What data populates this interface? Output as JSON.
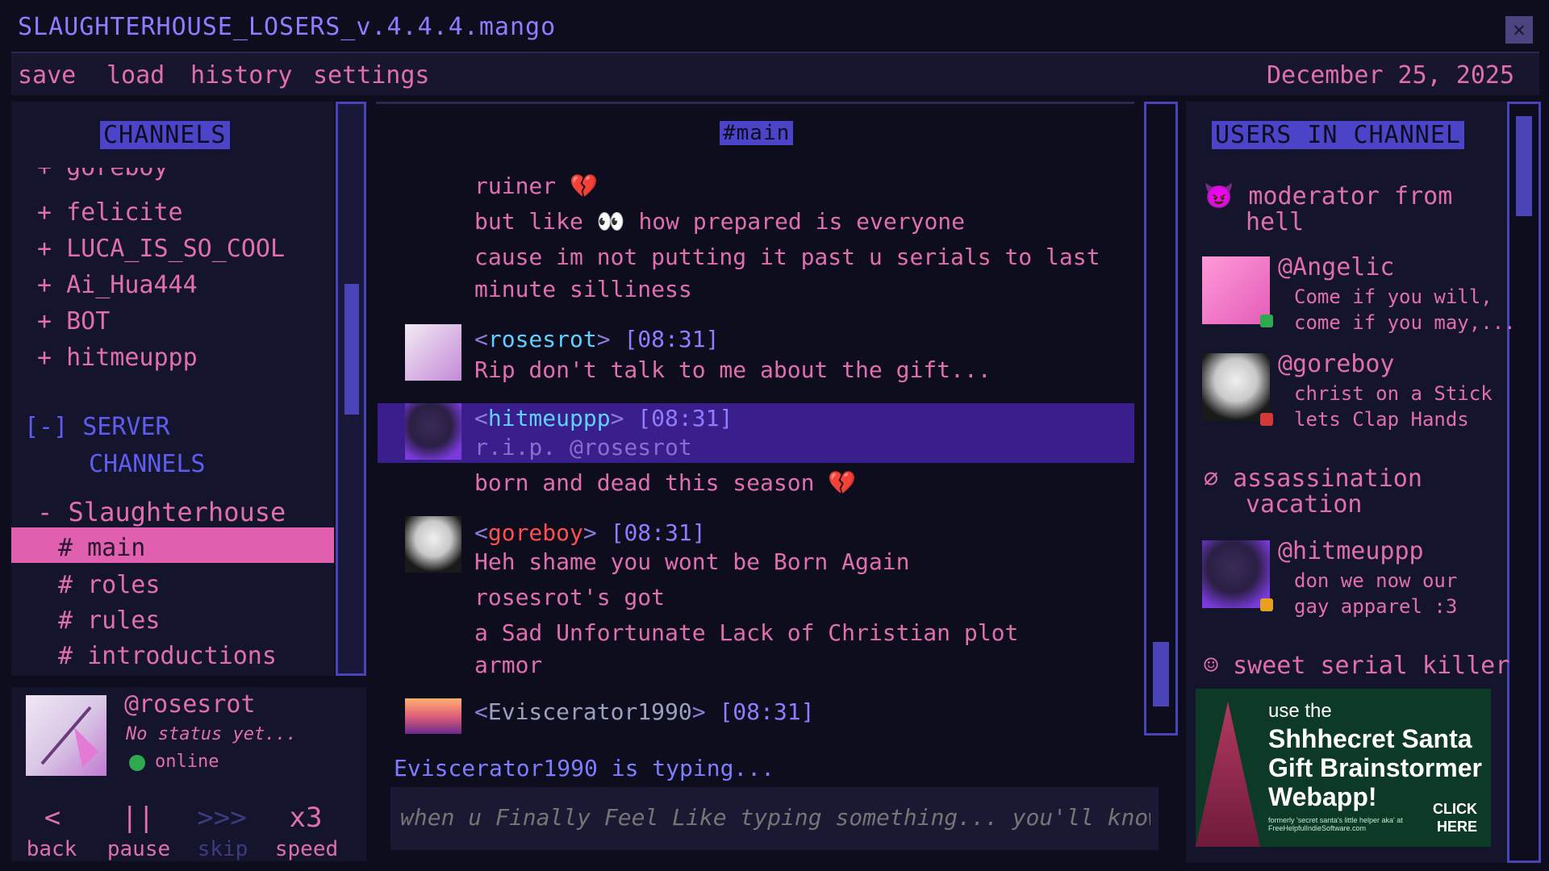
{
  "window": {
    "title": "SLAUGHTERHOUSE_LOSERS_v.4.4.4.mango"
  },
  "menu": {
    "items": [
      "save",
      "load",
      "history",
      "settings"
    ],
    "date": "December 25, 2025"
  },
  "channels": {
    "header": "CHANNELS",
    "users": [
      "+ felicite",
      "+ LUCA_IS_SO_COOL",
      "+ Ai_Hua444",
      "+ BOT",
      "+ hitmeuppp"
    ],
    "server_label": "[-] SERVER",
    "server_label2": "CHANNELS",
    "group": "- Slaughterhouse",
    "items": [
      "# main",
      "# roles",
      "# rules",
      "# introductions"
    ]
  },
  "profile": {
    "handle": "@rosesrot",
    "status_text": "No status yet...",
    "presence": "online"
  },
  "controls": [
    {
      "icon": "<",
      "label": "back"
    },
    {
      "icon": "||",
      "label": "pause"
    },
    {
      "icon": ">>>",
      "label": "skip"
    },
    {
      "icon": "x3",
      "label": "speed"
    }
  ],
  "chat": {
    "channel": "#main",
    "lines": [
      "ruiner 💔",
      "but like 👀 how prepared is everyone",
      "cause im not putting it past u serials to last",
      "minute silliness"
    ],
    "messages": [
      {
        "nick": "rosesrot",
        "time": "[08:31]",
        "text": [
          "Rip don't talk to me about the gift..."
        ]
      },
      {
        "nick": "hitmeuppp",
        "time": "[08:31]",
        "text": [
          "r.i.p. @rosesrot",
          "born and dead this season 💔"
        ]
      },
      {
        "nick": "goreboy",
        "time": "[08:31]",
        "text": [
          "Heh shame you wont be Born Again",
          "rosesrot's got",
          "a Sad Unfortunate Lack of Christian plot",
          "armor"
        ]
      },
      {
        "nick": "Eviscerator1990",
        "time": "[08:31]",
        "text": []
      }
    ],
    "typing": "Eviscerator1990 is typing...",
    "input_placeholder": "when u Finally Feel Like typing something... you'll know"
  },
  "users": {
    "header": "USERS IN CHANNEL",
    "roles": [
      {
        "icon": "😈",
        "label": "moderator from",
        "label2": "hell"
      },
      {
        "icon": "∅",
        "label": "assassination",
        "label2": "vacation"
      },
      {
        "icon": "☺",
        "label": "sweet serial killer"
      }
    ],
    "members": [
      {
        "handle": "@Angelic",
        "status1": "Come if you will,",
        "status2": "come if you may,...",
        "dot_color": "#2fa84f"
      },
      {
        "handle": "@goreboy",
        "status1": "christ on a Stick",
        "status2": "lets Clap Hands",
        "dot_color": "#d23a3a"
      },
      {
        "handle": "@hitmeuppp",
        "status1": "don we now our",
        "status2": "gay apparel :3",
        "dot_color": "#e8a020"
      }
    ]
  },
  "ad": {
    "line1": "use the",
    "line2": "Shhhecret Santa Gift Brainstormer Webapp!",
    "click": "CLICK\nHERE",
    "fine": "formerly 'secret santa's little helper aka' at FreeHelpfulIndieSoftware.com"
  },
  "colors": {
    "accent_pink": "#e06fb0",
    "accent_blue": "#4b44c8",
    "highlight": "#3a1f8c",
    "bg": "#0e0d1e"
  }
}
